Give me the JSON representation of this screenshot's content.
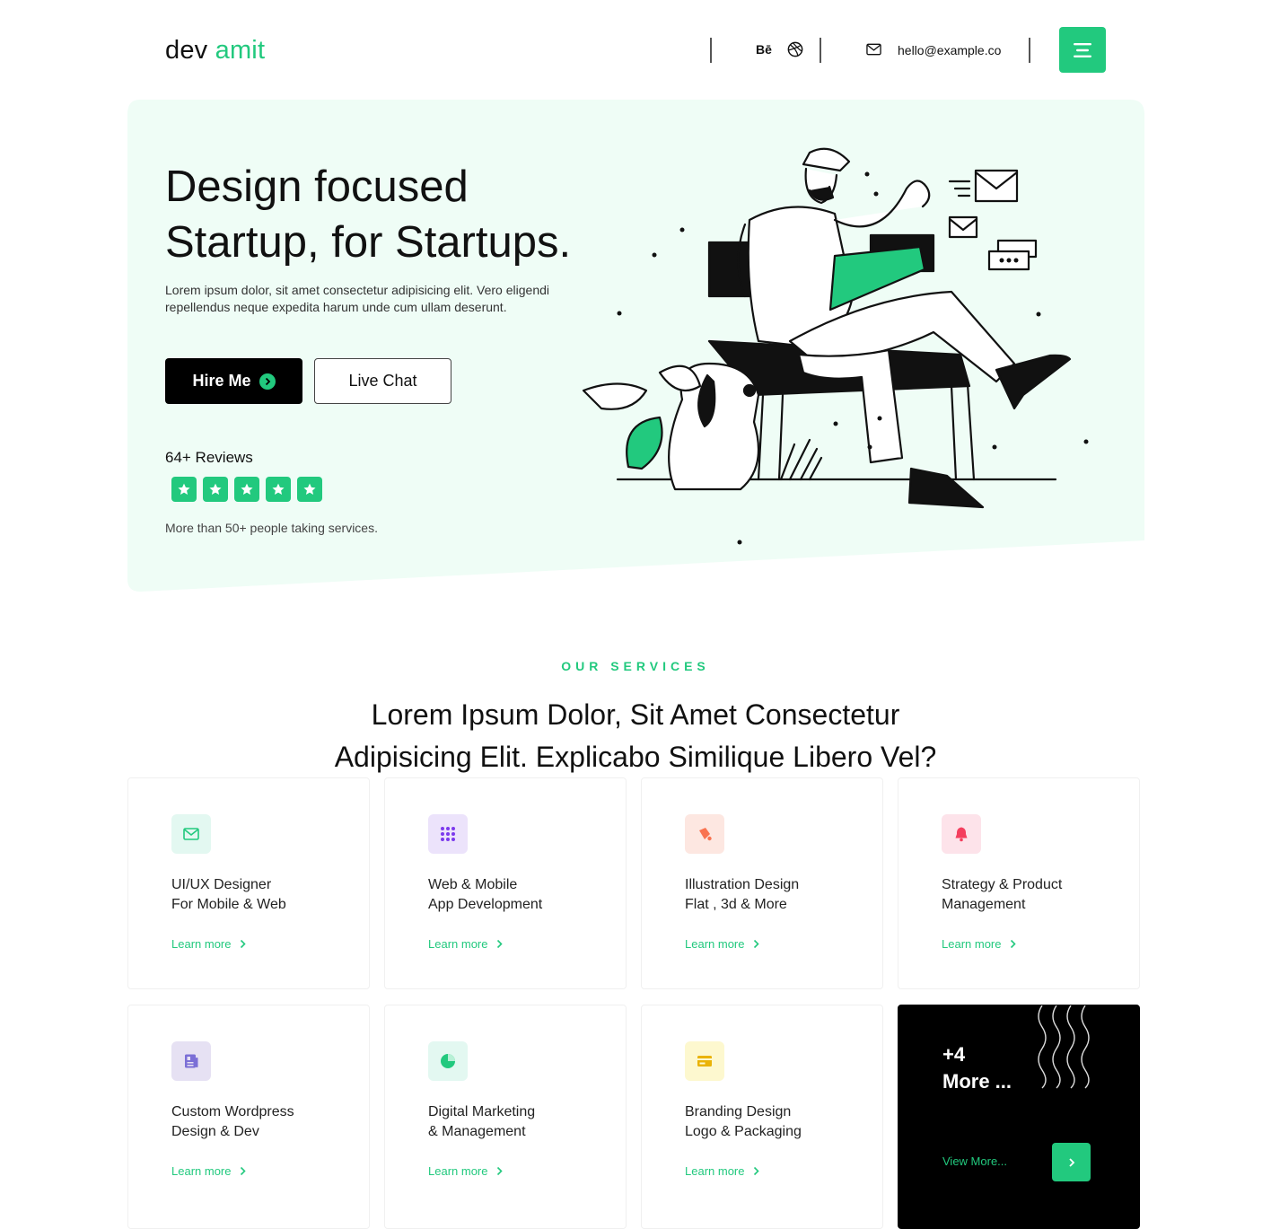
{
  "header": {
    "logo_first": "dev",
    "logo_second": "amit",
    "behance_label": "Bē",
    "email": "hello@example.co"
  },
  "hero": {
    "title": "Design focused\nStartup, for Startups.",
    "description": "Lorem ipsum dolor, sit amet consectetur adipisicing elit. Vero eligendi repellendus neque expedita harum unde cum ullam deserunt.",
    "hire_label": "Hire Me",
    "chat_label": "Live Chat",
    "reviews_label": "64+ Reviews",
    "rating_stars": 5,
    "taking_text": "More than 50+ people taking services."
  },
  "services": {
    "kicker": "OUR SERVICES",
    "title": "Lorem Ipsum Dolor, Sit Amet Consectetur\nAdipisicing Elit. Explicabo Similique Libero Vel?",
    "learn_label": "Learn more",
    "cards": [
      {
        "title": "UI/UX Designer\nFor Mobile & Web",
        "icon": "mail-icon",
        "color": "#22c97e"
      },
      {
        "title": "Web & Mobile\nApp Development",
        "icon": "grid-dots-icon",
        "color": "#7c3aed"
      },
      {
        "title": "Illustration Design\nFlat , 3d & More",
        "icon": "paint-icon",
        "color": "#f97350"
      },
      {
        "title": "Strategy & Product\nManagement",
        "icon": "bell-icon",
        "color": "#f43f5e"
      },
      {
        "title": "Custom Wordpress\nDesign & Dev",
        "icon": "document-icon",
        "color": "#7b6fd6"
      },
      {
        "title": "Digital Marketing\n& Management",
        "icon": "pie-chart-icon",
        "color": "#22c97e"
      },
      {
        "title": "Branding Design\nLogo & Packaging",
        "icon": "card-icon",
        "color": "#eab308"
      }
    ],
    "more_card": {
      "count": "+4\nMore ...",
      "view_label": "View More..."
    }
  },
  "colors": {
    "accent": "#22c97e",
    "hero_bg": "#effdf6",
    "dark": "#000000"
  }
}
